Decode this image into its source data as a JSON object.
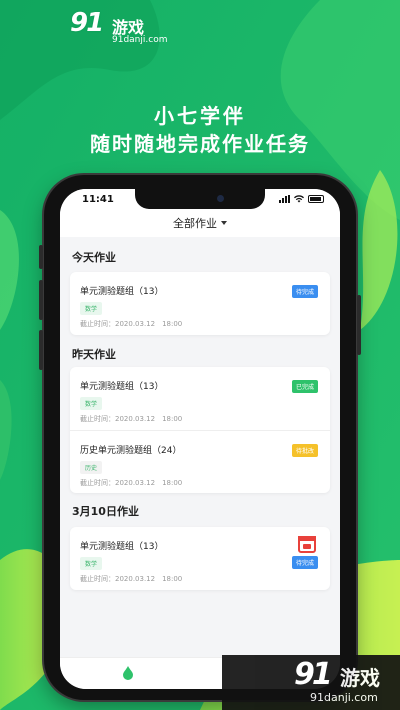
{
  "colors": {
    "bg_dark": "#0fa860",
    "bg_light": "#b8ec4a",
    "accent_green": "#2ec26b",
    "badge_blue": "#3a8ef0",
    "badge_yellow": "#f5c12a"
  },
  "top_logo": {
    "mark": "91",
    "word": "游戏",
    "url": "91danji.com"
  },
  "headline": {
    "line1": "小七学伴",
    "line2": "随时随地完成作业任务"
  },
  "status": {
    "time": "11:41"
  },
  "filter": {
    "label": "全部作业"
  },
  "sections": [
    {
      "title": "今天作业",
      "items": [
        {
          "name": "单元测验题组（13）",
          "subject": "数学",
          "deadline": "截止时间：2020.03.12　18:00",
          "status": "待完成",
          "status_color": "#3a8ef0"
        }
      ]
    },
    {
      "title": "昨天作业",
      "items": [
        {
          "name": "单元测验题组（13）",
          "subject": "数学",
          "deadline": "截止时间：2020.03.12　18:00",
          "status": "已完成",
          "status_color": "#2ec26b"
        },
        {
          "name": "历史单元测验题组（24）",
          "subject": "历史",
          "deadline": "截止时间：2020.03.12　18:00",
          "status": "待批改",
          "status_color": "#f5c12a"
        }
      ]
    },
    {
      "title": "3月10日作业",
      "items": [
        {
          "name": "单元测验题组（13）",
          "subject": "数学",
          "deadline": "截止时间：2020.03.12　18:00",
          "status": "待完成",
          "status_color": "#3a8ef0",
          "icon": "calendar-icon"
        }
      ]
    }
  ],
  "bottom_logo": {
    "mark": "91",
    "word": "游戏",
    "url": "91danji.com"
  }
}
